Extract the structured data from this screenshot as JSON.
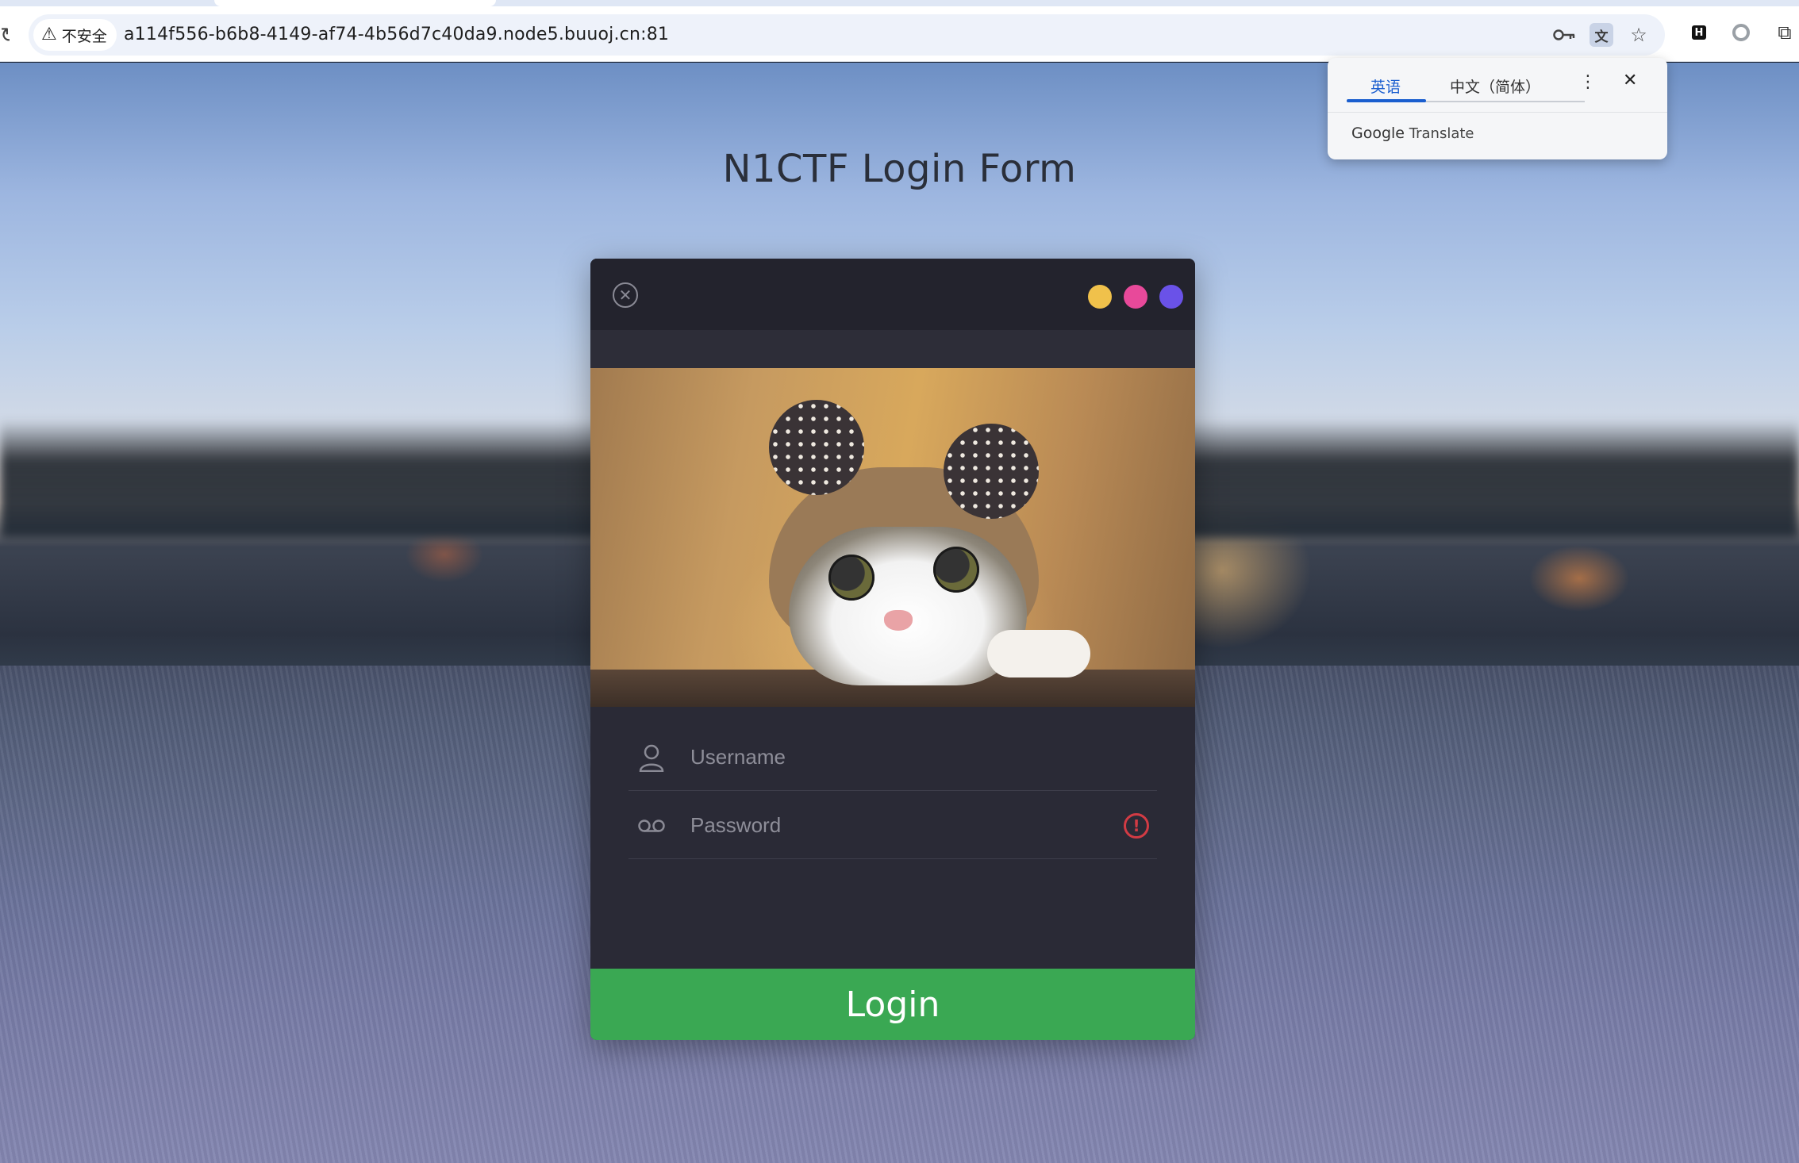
{
  "browser": {
    "security_label": "不安全",
    "url": "a114f556-b6b8-4149-af74-4b56d7c40da9.node5.buuoj.cn:81",
    "icons": [
      "reload-icon",
      "warning-icon",
      "key-icon",
      "translate-icon",
      "star-icon",
      "extension-h-icon",
      "extension-circle-icon",
      "extensions-icon"
    ]
  },
  "translate_popup": {
    "tab_source": "英语",
    "tab_target": "中文（简体）",
    "brand_google": "Google",
    "brand_translate": "Translate"
  },
  "page": {
    "title": "N1CTF Login Form"
  },
  "card": {
    "dots": [
      "#f0c14b",
      "#e8499a",
      "#6a52e8"
    ],
    "username_placeholder": "Username",
    "password_placeholder": "Password",
    "error_icon_text": "!",
    "login_label": "Login",
    "login_color": "#3aa853"
  }
}
